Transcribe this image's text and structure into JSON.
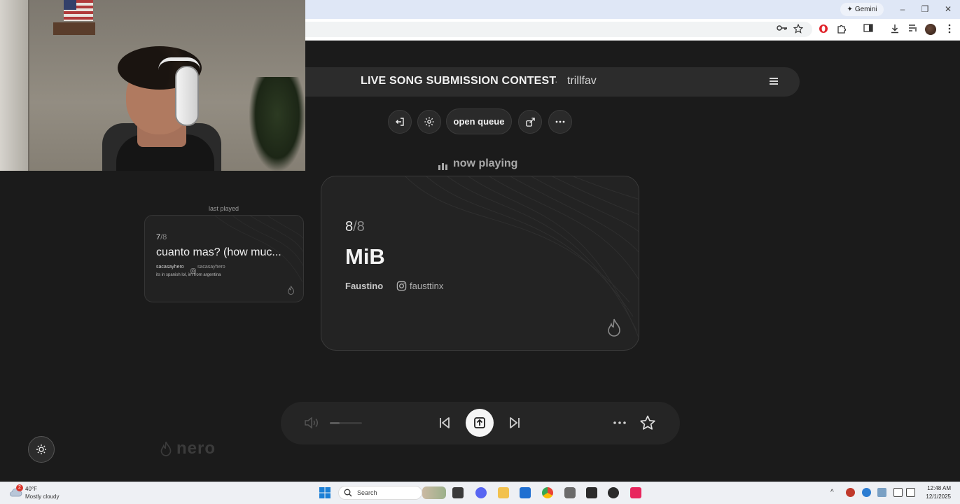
{
  "browser": {
    "gemini_label": "Gemini",
    "window_controls": {
      "minimize": "–",
      "restore": "❐",
      "close": "✕"
    }
  },
  "app": {
    "header": {
      "title": "LIVE SONG SUBMISSION CONTEST",
      "separator": "·",
      "username": "trillfav"
    },
    "toolbar": {
      "open_queue_label": "open queue"
    },
    "now_playing_label": "now playing",
    "now_playing": {
      "position": "8",
      "total": "/8",
      "title": "MiB",
      "artist": "Faustino",
      "instagram": "fausttinx"
    },
    "last_played_label": "last played",
    "last_played": {
      "position": "7",
      "total": "/8",
      "title": "cuanto mas? (how muc...",
      "artist": "sacasayhero",
      "instagram": "sacasayhero",
      "note": "its in spanish lol, im from argentina"
    },
    "player": {
      "volume_level": 0.3
    },
    "brand": "nero"
  },
  "taskbar": {
    "weather_badge": "2",
    "weather_temp": "40°F",
    "weather_desc": "Mostly cloudy",
    "search_placeholder": "Search",
    "time": "12:48 AM",
    "date": "12/1/2025"
  },
  "colors": {
    "app_bg": "#1b1b1b",
    "card_bg": "#232323",
    "browser_titlebar": "#dfe7f6",
    "taskbar_bg": "#eef0f4"
  }
}
